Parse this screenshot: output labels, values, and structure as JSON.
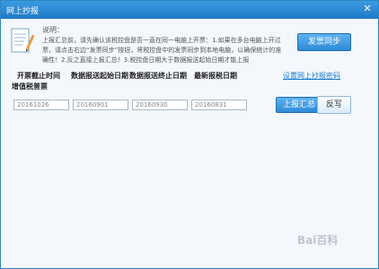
{
  "window": {
    "title": "网上抄报"
  },
  "description": {
    "heading": "说明：",
    "body": "上报汇总前，请先确认该税控盘是否一直在同一电脑上开票：1.如果在多台电脑上开过票，请点击右边“发票同步”按钮，将税控盘中的发票同步到本地电脑，以确保统计的准确性！2.反之直接上报汇总！3.税控盘日期大于数据报送起始日期才能上报"
  },
  "buttons": {
    "sync": "发票同步",
    "upload": "上报汇总",
    "reverse": "反写"
  },
  "settings_link": "设置网上抄报密码",
  "columns": [
    "开票截止时间",
    "数据报送起始日期",
    "数据报送终止日期",
    "最新报税日期"
  ],
  "section_label": "增值税普票",
  "fields": [
    "20161026",
    "20160901",
    "20160930",
    "20160831"
  ],
  "watermark": "Bai百科",
  "colors": {
    "title_bar": "#2a8ad6",
    "accent": "#1a7bd1",
    "background": "#f4f7fb"
  }
}
